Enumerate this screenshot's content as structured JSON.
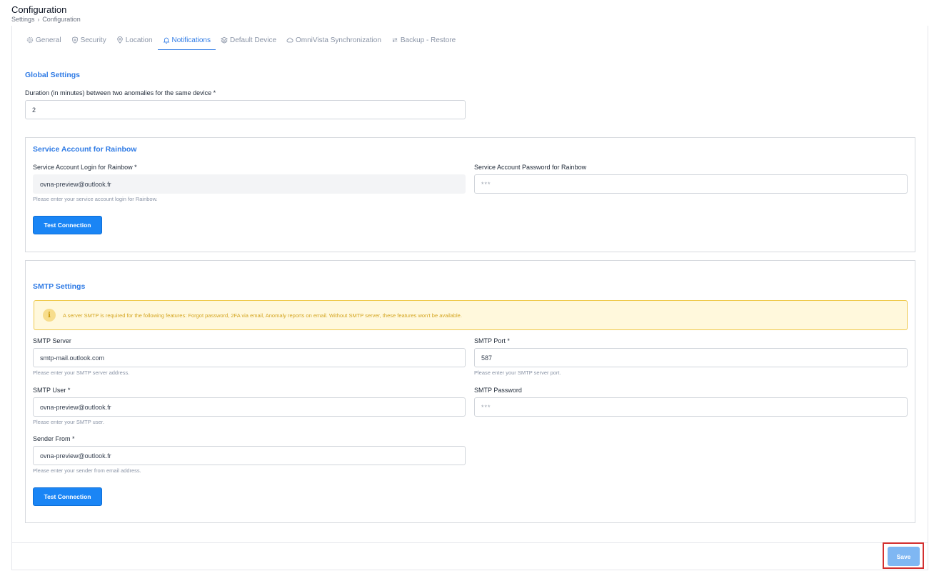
{
  "header": {
    "title": "Configuration",
    "breadcrumb": [
      "Settings",
      "Configuration"
    ]
  },
  "tabs": [
    {
      "label": "General",
      "icon": "gear-icon"
    },
    {
      "label": "Security",
      "icon": "shield-icon"
    },
    {
      "label": "Location",
      "icon": "map-pin-icon"
    },
    {
      "label": "Notifications",
      "icon": "bell-icon",
      "active": true
    },
    {
      "label": "Default Device",
      "icon": "layers-icon"
    },
    {
      "label": "OmniVista Synchronization",
      "icon": "cloud-icon"
    },
    {
      "label": "Backup - Restore",
      "icon": "refresh-icon"
    }
  ],
  "global": {
    "title": "Global Settings",
    "duration_label": "Duration (in minutes) between two anomalies for the same device *",
    "duration_value": "2"
  },
  "rainbow": {
    "title": "Service Account for Rainbow",
    "login_label": "Service Account Login for Rainbow *",
    "login_value": "ovna-preview@outlook.fr",
    "login_help": "Please enter your service account login for Rainbow.",
    "password_label": "Service Account Password for Rainbow",
    "password_value": "***",
    "test_button": "Test Connection"
  },
  "smtp": {
    "title": "SMTP Settings",
    "alert": "A server SMTP is required for the following features: Forgot password, 2FA via email, Anomaly reports on email. Without SMTP server, these features won't be available.",
    "server_label": "SMTP Server",
    "server_value": "smtp-mail.outlook.com",
    "server_help": "Please enter your SMTP server address.",
    "port_label": "SMTP Port *",
    "port_value": "587",
    "port_help": "Please enter your SMTP server port.",
    "user_label": "SMTP User *",
    "user_value": "ovna-preview@outlook.fr",
    "user_help": "Please enter your SMTP user.",
    "password_label": "SMTP Password",
    "password_value": "***",
    "sender_label": "Sender From *",
    "sender_value": "ovna-preview@outlook.fr",
    "sender_help": "Please enter your sender from email address.",
    "test_button": "Test Connection"
  },
  "footer": {
    "save_label": "Save"
  },
  "colors": {
    "accent": "#2f7be5",
    "button": "#1a85f5",
    "save_disabled": "#7fb7f3",
    "alert_bg": "#fff8dc",
    "alert_border": "#efc94c",
    "highlight": "#d32f2f"
  }
}
